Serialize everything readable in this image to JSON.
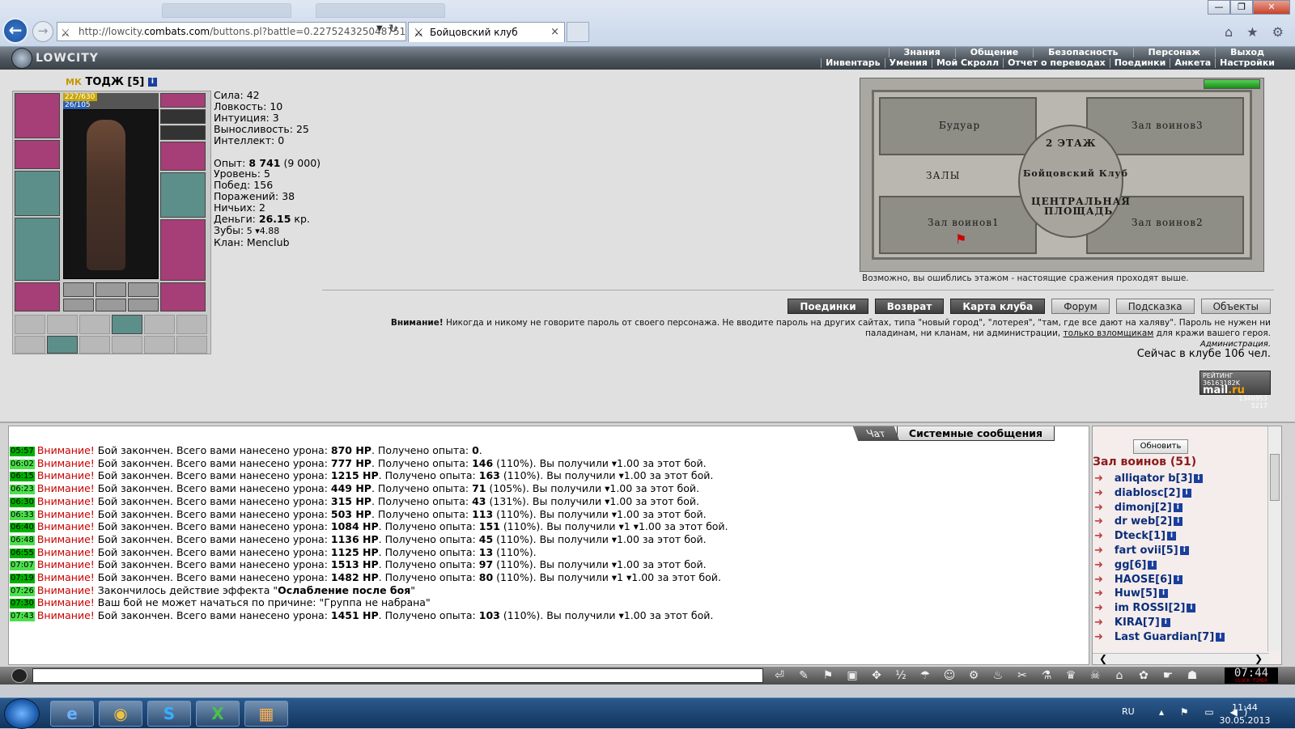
{
  "browser": {
    "url_prefix": "http://lowcity.",
    "url_host": "combats.com",
    "url_path": "/buttons.pl?battle=0.227524325048751",
    "tab_title": "Бойцовский клуб",
    "tab_close": "×",
    "back": "←",
    "forward": "→",
    "win_min": "—",
    "win_max": "❐",
    "win_close": "✕",
    "tool_icons": "⌂ ★ ⚙"
  },
  "game": {
    "logo": "LOWCITY",
    "menu_top": [
      "Знания",
      "Общение",
      "Безопасность",
      "Персонаж",
      "Выход"
    ],
    "menu_bottom": [
      "Инвентарь",
      "Умения",
      "Мой Скролл",
      "Отчет о переводах",
      "Поединки",
      "Анкета",
      "Настройки"
    ]
  },
  "character": {
    "clan_tag": "МК",
    "name": "ТОДЖ",
    "level_tag": "[5]",
    "hp": "227/630",
    "hp_ratio": 0.36,
    "mana": "26/105",
    "mana_ratio": 0.25,
    "stats": [
      {
        "label": "Сила:",
        "value": "42"
      },
      {
        "label": "Ловкость:",
        "value": "10"
      },
      {
        "label": "Интуиция:",
        "value": "3"
      },
      {
        "label": "Выносливость:",
        "value": "25"
      },
      {
        "label": "Интеллект:",
        "value": "0"
      }
    ],
    "exp_label": "Опыт:",
    "exp_value": "8 741",
    "exp_next": "(9 000)",
    "level_label": "Уровень:",
    "level_value": "5",
    "wins_label": "Побед:",
    "wins_value": "156",
    "losses_label": "Поражений:",
    "losses_value": "38",
    "draws_label": "Ничьих:",
    "draws_value": "2",
    "money_label": "Деньги:",
    "money_value": "26.15",
    "money_unit": "кр.",
    "teeth_label": "Зубы:",
    "teeth_value": "5 ▾4.88",
    "clan_label": "Клан:",
    "clan_value": "Menclub"
  },
  "map": {
    "labels": {
      "boudoir": "Будуар",
      "hall3": "Зал воинов3",
      "floor": "2 ЭТАЖ",
      "club": "Бойцовский Клуб",
      "halls": "ЗАЛЫ",
      "central1": "ЦЕНТРАЛЬНАЯ",
      "central2": "ПЛОЩАДЬ",
      "hall1": "Зал воинов1",
      "hall2": "Зал воинов2"
    },
    "hp_ratio": 1.0,
    "note": "Возможно, вы ошиблись этажом - настоящие сражения проходят выше."
  },
  "actions": {
    "buttons": [
      "Поединки",
      "Возврат",
      "Карта клуба"
    ],
    "light_buttons": [
      "Форум",
      "Подсказка",
      "Объекты"
    ]
  },
  "warning": {
    "bold": "Внимание!",
    "text1": " Никогда и никому не говорите пароль от своего персонажа. Не вводите пароль на других сайтах, типа \"новый город\", \"лотерея\", \"там, где все дают на халяву\". Пароль не нужен ни паладинам, ни кланам, ни администрации, ",
    "link": "только взломщикам",
    "text2": " для кражи вашего героя.",
    "signature": "Администрация.",
    "online": "Сейчас в клубе 106 чел."
  },
  "rating": {
    "line1": "РЕЙТИНГ 36163182K",
    "line2": "1346953",
    "line3": "5217",
    "brand_mail": "mail",
    "brand_ru": ".ru"
  },
  "chat": {
    "tab_chat": "Чат",
    "tab_system": "Системные сообщения",
    "attention": "Внимание!",
    "messages": [
      {
        "time": "05:57",
        "pre": "Бой закончен. Всего вами нанесено урона: ",
        "dmg": "870 HP",
        "mid": ". Получено опыта: ",
        "exp": "0",
        "post": "."
      },
      {
        "time": "06:02",
        "pre": "Бой закончен. Всего вами нанесено урона: ",
        "dmg": "777 HP",
        "mid": ". Получено опыта: ",
        "exp": "146",
        "post": " (110%). Вы получили ▾1.00 за этот бой."
      },
      {
        "time": "06:15",
        "pre": "Бой закончен. Всего вами нанесено урона: ",
        "dmg": "1215 HP",
        "mid": ". Получено опыта: ",
        "exp": "163",
        "post": " (110%). Вы получили ▾1.00 за этот бой."
      },
      {
        "time": "06:23",
        "pre": "Бой закончен. Всего вами нанесено урона: ",
        "dmg": "449 HP",
        "mid": ". Получено опыта: ",
        "exp": "71",
        "post": " (105%). Вы получили ▾1.00 за этот бой."
      },
      {
        "time": "06:30",
        "pre": "Бой закончен. Всего вами нанесено урона: ",
        "dmg": "315 HP",
        "mid": ". Получено опыта: ",
        "exp": "43",
        "post": " (131%). Вы получили ▾1.00 за этот бой."
      },
      {
        "time": "06:33",
        "pre": "Бой закончен. Всего вами нанесено урона: ",
        "dmg": "503 HP",
        "mid": ". Получено опыта: ",
        "exp": "113",
        "post": " (110%). Вы получили ▾1.00 за этот бой."
      },
      {
        "time": "06:40",
        "pre": "Бой закончен. Всего вами нанесено урона: ",
        "dmg": "1084 HP",
        "mid": ". Получено опыта: ",
        "exp": "151",
        "post": " (110%). Вы получили ▾1 ▾1.00 за этот бой."
      },
      {
        "time": "06:48",
        "pre": "Бой закончен. Всего вами нанесено урона: ",
        "dmg": "1136 HP",
        "mid": ". Получено опыта: ",
        "exp": "45",
        "post": " (110%). Вы получили ▾1.00 за этот бой."
      },
      {
        "time": "06:55",
        "pre": "Бой закончен. Всего вами нанесено урона: ",
        "dmg": "1125 HP",
        "mid": ". Получено опыта: ",
        "exp": "13",
        "post": " (110%)."
      },
      {
        "time": "07:07",
        "pre": "Бой закончен. Всего вами нанесено урона: ",
        "dmg": "1513 HP",
        "mid": ". Получено опыта: ",
        "exp": "97",
        "post": " (110%). Вы получили ▾1.00 за этот бой."
      },
      {
        "time": "07:19",
        "pre": "Бой закончен. Всего вами нанесено урона: ",
        "dmg": "1482 HP",
        "mid": ". Получено опыта: ",
        "exp": "80",
        "post": " (110%). Вы получили ▾1 ▾1.00 за этот бой."
      },
      {
        "time": "07:26",
        "pre": "Закончилось действие эффекта \"",
        "dmg": "Ослабление после боя",
        "mid": "\"",
        "exp": "",
        "post": ""
      },
      {
        "time": "07:30",
        "pre": "Ваш бой не может начаться по причине: \"Группа не набрана\"",
        "dmg": "",
        "mid": "",
        "exp": "",
        "post": ""
      },
      {
        "time": "07:43",
        "pre": "Бой закончен. Всего вами нанесено урона: ",
        "dmg": "1451 HP",
        "mid": ". Получено опыта: ",
        "exp": "103",
        "post": " (110%). Вы получили ▾1.00 за этот бой."
      }
    ]
  },
  "users": {
    "refresh": "Обновить",
    "room": "Зал воинов (51)",
    "list": [
      {
        "name": "alliqator b",
        "lvl": "[3]"
      },
      {
        "name": "diablosc",
        "lvl": "[2]"
      },
      {
        "name": "dimonj",
        "lvl": "[2]"
      },
      {
        "name": "dr web",
        "lvl": "[2]"
      },
      {
        "name": "Dteck",
        "lvl": "[1]"
      },
      {
        "name": "fart ovii",
        "lvl": "[5]"
      },
      {
        "name": "gg",
        "lvl": "[6]"
      },
      {
        "name": "HAOSE",
        "lvl": "[6]"
      },
      {
        "name": "Huw",
        "lvl": "[5]"
      },
      {
        "name": "im ROSSI",
        "lvl": "[2]"
      },
      {
        "name": "KIRA",
        "lvl": "[7]"
      },
      {
        "name": "Last Guardian",
        "lvl": "[7]"
      }
    ],
    "scroll_left": "❮",
    "scroll_right": "❯"
  },
  "bottom": {
    "tool_icons": [
      "⏎",
      "✎",
      "⚑",
      "▣",
      "✥",
      "½",
      "☂",
      "☺",
      "⚙",
      "♨",
      "✂",
      "⚗",
      "♛",
      "☠",
      "⌂",
      "✿",
      "☛",
      "☗"
    ],
    "clock": "07:44",
    "clock_sub": "CLOCK TIMER"
  },
  "taskbar": {
    "apps": [
      "e",
      "◉",
      "S",
      "X",
      "▦"
    ],
    "lang": "RU",
    "tray_icons": "▴ ⚑ ▭ ◀)",
    "time": "11:44",
    "date": "30.05.2013"
  }
}
